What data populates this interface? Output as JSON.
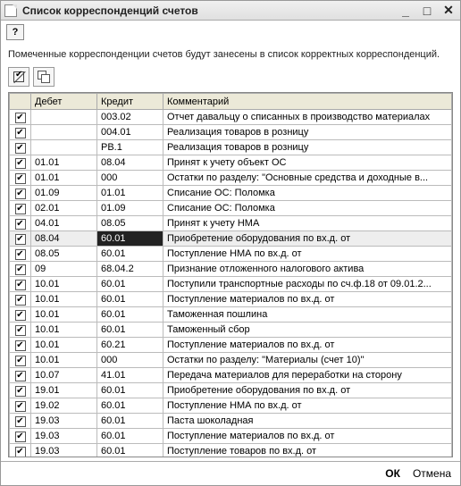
{
  "window": {
    "title": "Список корреспонденций счетов"
  },
  "help": {
    "label": "?"
  },
  "instruction": "Помеченные корреспонденции счетов будут занесены в список корректных корреспонденций.",
  "columns": {
    "checkbox": "",
    "debit": "Дебет",
    "credit": "Кредит",
    "comment": "Комментарий"
  },
  "selected_index": 8,
  "rows": [
    {
      "c": true,
      "d": "",
      "k": "003.02",
      "m": "Отчет давальцу о списанных в производство материалах"
    },
    {
      "c": true,
      "d": "",
      "k": "004.01",
      "m": "Реализация товаров в розницу"
    },
    {
      "c": true,
      "d": "",
      "k": "РВ.1",
      "m": "Реализация товаров в розницу"
    },
    {
      "c": true,
      "d": "01.01",
      "k": "08.04",
      "m": "Принят к учету объект ОС"
    },
    {
      "c": true,
      "d": "01.01",
      "k": "000",
      "m": "Остатки по разделу: \"Основные средства и доходные в..."
    },
    {
      "c": true,
      "d": "01.09",
      "k": "01.01",
      "m": "Списание ОС: Поломка"
    },
    {
      "c": true,
      "d": "02.01",
      "k": "01.09",
      "m": "Списание ОС: Поломка"
    },
    {
      "c": true,
      "d": "04.01",
      "k": "08.05",
      "m": "Принят к учету НМА"
    },
    {
      "c": true,
      "d": "08.04",
      "k": "60.01",
      "m": "Приобретение оборудования по вх.д. от"
    },
    {
      "c": true,
      "d": "08.05",
      "k": "60.01",
      "m": "Поступление НМА по вх.д. от"
    },
    {
      "c": true,
      "d": "09",
      "k": "68.04.2",
      "m": "Признание отложенного налогового актива"
    },
    {
      "c": true,
      "d": "10.01",
      "k": "60.01",
      "m": "Поступили транспортные расходы по сч.ф.18 от 09.01.2..."
    },
    {
      "c": true,
      "d": "10.01",
      "k": "60.01",
      "m": "Поступление материалов по вх.д. от"
    },
    {
      "c": true,
      "d": "10.01",
      "k": "60.01",
      "m": "Таможенная пошлина"
    },
    {
      "c": true,
      "d": "10.01",
      "k": "60.01",
      "m": "Таможенный сбор"
    },
    {
      "c": true,
      "d": "10.01",
      "k": "60.21",
      "m": "Поступление материалов по вх.д. от"
    },
    {
      "c": true,
      "d": "10.01",
      "k": "000",
      "m": "Остатки по разделу: \"Материалы (счет 10)\""
    },
    {
      "c": true,
      "d": "10.07",
      "k": "41.01",
      "m": "Передача материалов для переработки на сторону"
    },
    {
      "c": true,
      "d": "19.01",
      "k": "60.01",
      "m": "Приобретение оборудования по вх.д. от"
    },
    {
      "c": true,
      "d": "19.02",
      "k": "60.01",
      "m": "Поступление НМА по вх.д. от"
    },
    {
      "c": true,
      "d": "19.03",
      "k": "60.01",
      "m": "Паста шоколадная"
    },
    {
      "c": true,
      "d": "19.03",
      "k": "60.01",
      "m": "Поступление материалов по вх.д. от"
    },
    {
      "c": true,
      "d": "19.03",
      "k": "60.01",
      "m": "Поступление товаров по вх.д. от"
    }
  ],
  "footer": {
    "ok": "ОК",
    "cancel": "Отмена"
  }
}
